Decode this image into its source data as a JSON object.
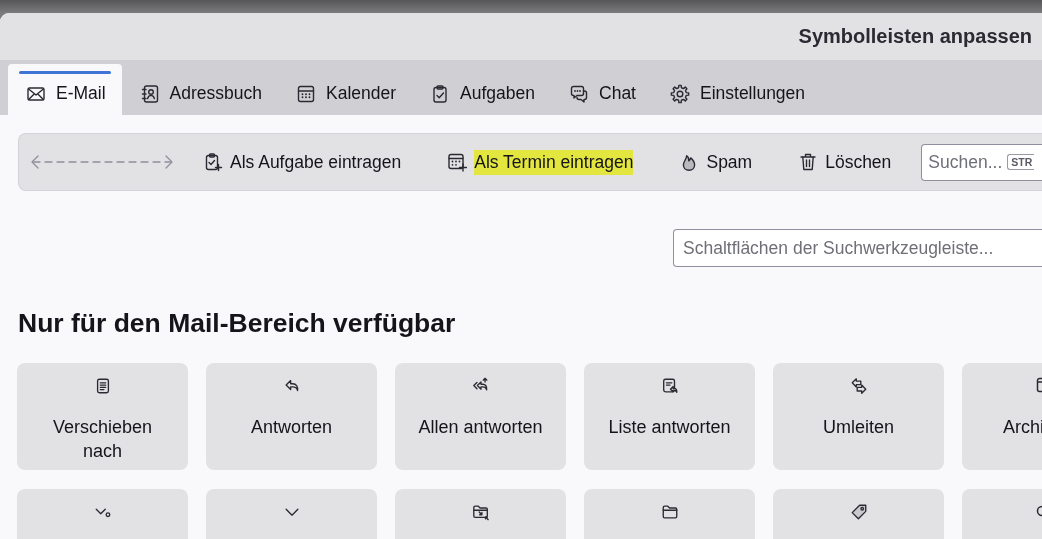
{
  "window": {
    "title": "Symbolleisten anpassen"
  },
  "tabs": [
    {
      "label": "E-Mail",
      "selected": true
    },
    {
      "label": "Adressbuch",
      "selected": false
    },
    {
      "label": "Kalender",
      "selected": false
    },
    {
      "label": "Aufgaben",
      "selected": false
    },
    {
      "label": "Chat",
      "selected": false
    },
    {
      "label": "Einstellungen",
      "selected": false
    }
  ],
  "toolbar": {
    "items": [
      {
        "kind": "spacer"
      },
      {
        "kind": "button",
        "label": "Als Aufgabe eintragen",
        "highlighted": false
      },
      {
        "kind": "button",
        "label": "Als Termin eintragen",
        "highlighted": true
      },
      {
        "kind": "button",
        "label": "Spam",
        "highlighted": false
      },
      {
        "kind": "button",
        "label": "Löschen",
        "highlighted": false
      }
    ],
    "search": {
      "placeholder": "Suchen...",
      "shortcut": "STR"
    }
  },
  "button_filter": {
    "placeholder": "Schaltflächen der Suchwerkzeugleiste..."
  },
  "section": {
    "heading": "Nur für den Mail-Bereich verfügbar",
    "tiles": [
      {
        "kind": "whole",
        "label": "Verschieben nach"
      },
      {
        "kind": "whole",
        "label": "Antworten"
      },
      {
        "kind": "whole",
        "label": "Allen antworten"
      },
      {
        "kind": "whole",
        "label": "Liste antworten"
      },
      {
        "kind": "whole",
        "label": "Umleiten"
      },
      {
        "kind": "cut-right",
        "label": "Archi"
      },
      {
        "kind": "cut-bottom"
      },
      {
        "kind": "cut-bottom"
      },
      {
        "kind": "cut-bottom"
      },
      {
        "kind": "cut-bottom"
      },
      {
        "kind": "cut-bottom"
      },
      {
        "kind": "cut-corner"
      }
    ]
  }
}
